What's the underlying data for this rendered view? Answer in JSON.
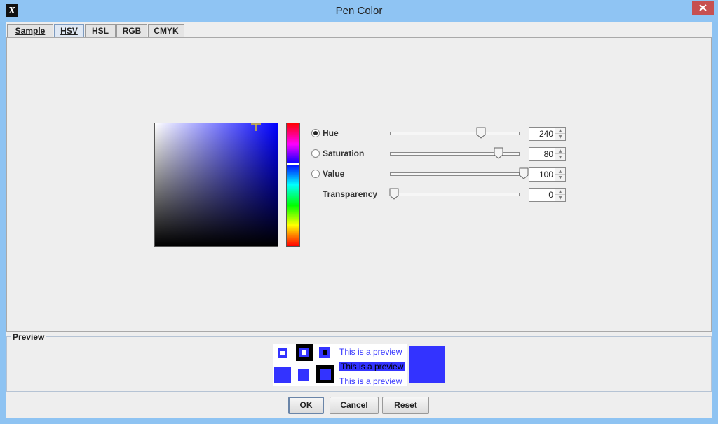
{
  "window": {
    "title": "Pen Color",
    "app_icon_glyph": "X"
  },
  "tabs": [
    {
      "label": "Sample",
      "active": false
    },
    {
      "label": "HSV",
      "active": true
    },
    {
      "label": "HSL",
      "active": false
    },
    {
      "label": "RGB",
      "active": false
    },
    {
      "label": "CMYK",
      "active": false
    }
  ],
  "hsv": {
    "hue": {
      "label": "Hue",
      "value": "240",
      "selected": true,
      "fraction": 0.67
    },
    "saturation": {
      "label": "Saturation",
      "value": "80",
      "selected": false,
      "fraction": 0.8
    },
    "value": {
      "label": "Value",
      "value": "100",
      "selected": false,
      "fraction": 1.0
    },
    "transparency": {
      "label": "Transparency",
      "value": "0",
      "fraction": 0.0
    }
  },
  "preview": {
    "legend": "Preview",
    "text_lines": [
      "This is a preview",
      "This is a preview",
      "This is a preview"
    ],
    "color": "#3333ff"
  },
  "buttons": {
    "ok": "OK",
    "cancel": "Cancel",
    "reset": "Reset"
  },
  "colors": {
    "titlebar": "#8fc4f3",
    "close": "#c75050",
    "selected_color": "#3333ff"
  }
}
